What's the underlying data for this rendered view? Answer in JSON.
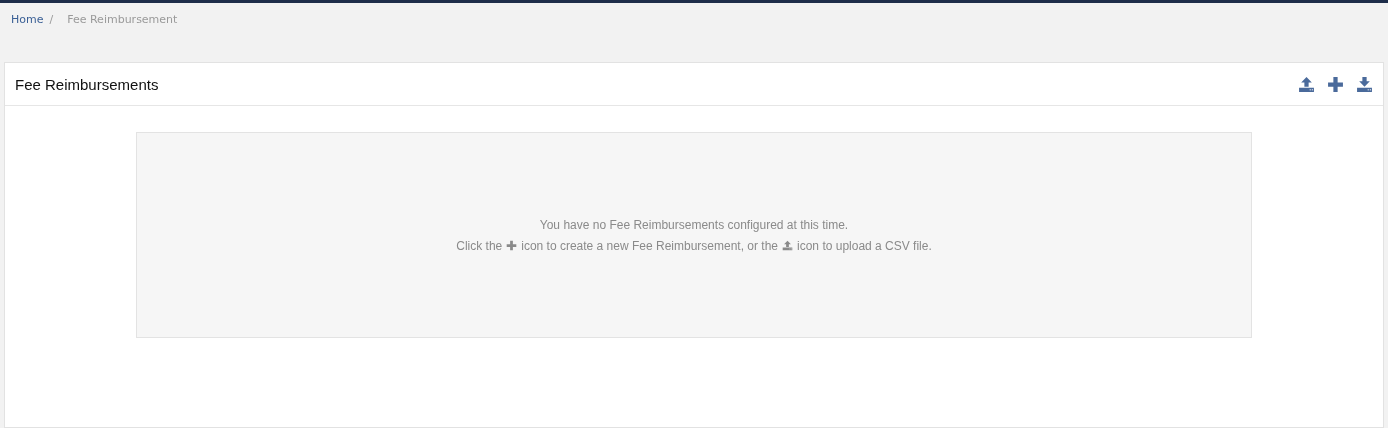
{
  "breadcrumb": [
    {
      "label": "Home",
      "kind": "link"
    },
    {
      "label": "/",
      "kind": "separator"
    },
    {
      "label": "Fee Reimbursement",
      "kind": "current"
    }
  ],
  "panel": {
    "title": "Fee Reimbursements",
    "toolbar": [
      {
        "kind": "upload"
      },
      {
        "kind": "add"
      },
      {
        "kind": "download"
      }
    ],
    "empty_state": {
      "message": "You have no Fee Reimbursements configured at this time.",
      "hint": [
        {
          "kind": "text",
          "text": "Click the"
        },
        {
          "kind": "add"
        },
        {
          "kind": "text",
          "text": "icon to create a new Fee Reimbursement, or the"
        },
        {
          "kind": "upload"
        },
        {
          "kind": "text",
          "text": "icon to upload a CSV file."
        }
      ]
    }
  }
}
